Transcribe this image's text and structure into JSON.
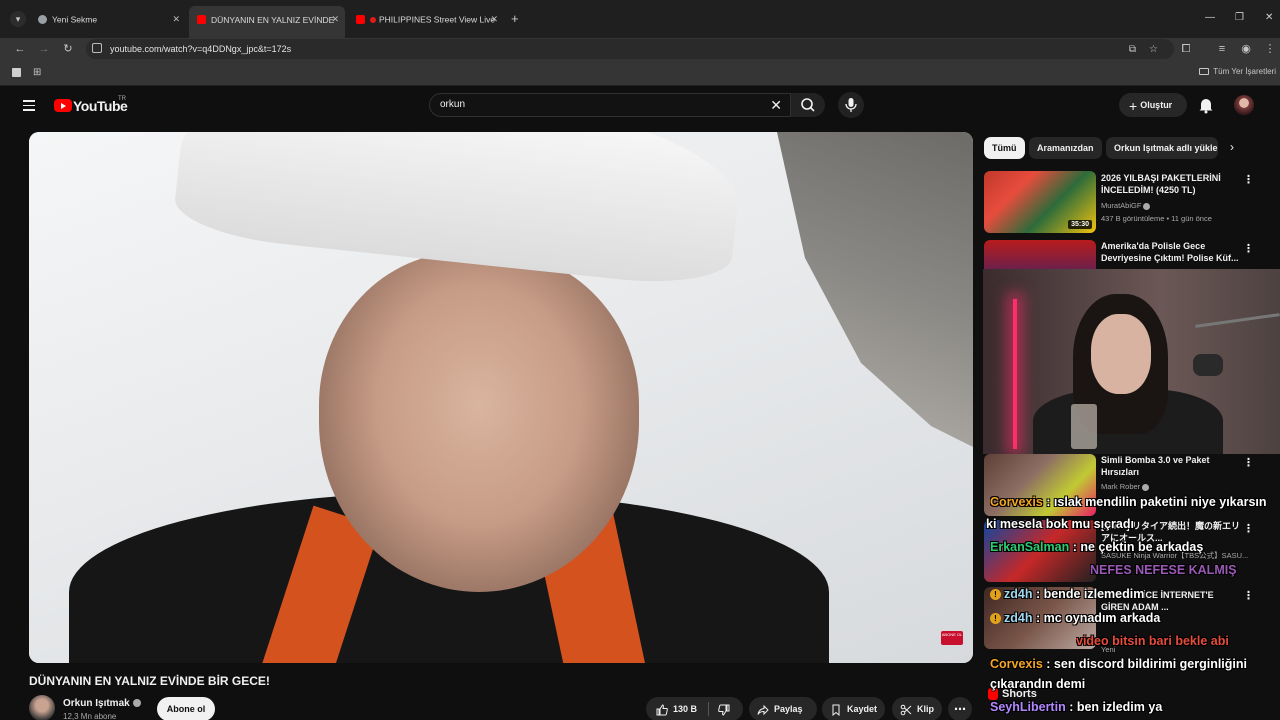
{
  "browser": {
    "tabs": [
      {
        "title": "Yeni Sekme",
        "active": false
      },
      {
        "title": "DÜNYANIN EN YALNIZ EVİNDE",
        "active": true
      },
      {
        "title": "PHILIPPINES Street View Live",
        "active": false
      }
    ],
    "url": "youtube.com/watch?v=q4DDNgx_jpc&t=172s",
    "bookmarks_all": "Tüm Yer İşaretleri"
  },
  "youtube": {
    "logo_text": "YouTube",
    "country_code": "TR",
    "search_value": "orkun",
    "create_label": "Oluştur"
  },
  "video": {
    "title": "DÜNYANIN EN YALNIZ EVİNDE BİR GECE!",
    "watermark": "ABONE OL",
    "channel": "Orkun Işıtmak",
    "subscribers": "12,3 Mn abone",
    "subscribe_label": "Abone ol",
    "likes": "130 B",
    "share_label": "Paylaş",
    "save_label": "Kaydet",
    "clip_label": "Klip",
    "more_label": "⋯"
  },
  "chips": [
    "Tümü",
    "Aramanızdan",
    "Orkun Işıtmak adlı yükle"
  ],
  "recommendations": [
    {
      "title": "2026 YILBAŞI PAKETLERİNİ İNCELEDİM! (4250 TL)",
      "channel": "MuratAbiGF",
      "meta": "437 B görüntüleme • 11 gün önce",
      "duration": "35:30"
    },
    {
      "title": "Amerika'da Polisle Gece Devriyesine Çıktım! Polise Küf...",
      "channel": "",
      "meta": "",
      "duration": ""
    },
    {
      "title": "Simli Bomba 3.0 ve Paket Hırsızları",
      "channel": "Mark Rober",
      "meta": "",
      "duration": ""
    },
    {
      "title": "[26/39] リタイア続出！魔の新エリアにオールス...",
      "channel": "SASUKE Ninja Warrior【TBS公式】SASU...",
      "meta": "",
      "duration": ""
    },
    {
      "title": "KEN GİZLİCE İNTERNET'E GİREN ADAM ...",
      "channel": "",
      "meta": "Yeni",
      "duration": ""
    }
  ],
  "shorts_label": "Shorts",
  "chat": [
    {
      "user": "Corvexis",
      "message": "ıslak mendilin paketini niye yıkarsın",
      "color": "#f5a623"
    },
    {
      "user": "",
      "message": "ki mesela bok mu sıçradı",
      "color": "#ffffff"
    },
    {
      "user": "ErkanSalman",
      "message": "ne çektin be arkadaş",
      "color": "#2ecc71"
    },
    {
      "user": "",
      "message": "NEFES NEFESE KALMIŞ",
      "color": "#9b59b6"
    },
    {
      "user": "zd4h",
      "message": "bende izlemedim",
      "color": "#a0d8ef"
    },
    {
      "user": "zd4h",
      "message": "mc oynadım arkada",
      "color": "#a0d8ef"
    },
    {
      "user": "",
      "message": "video bitsin bari bekle abi",
      "color": "#e74c3c"
    },
    {
      "user": "Corvexis",
      "message": "sen discord bildirimi gerginliğini",
      "color": "#f5a623"
    },
    {
      "user": "",
      "message": "çıkarandın demi",
      "color": "#ffffff"
    },
    {
      "user": "SeyhLibertin",
      "message": "ben izledim ya",
      "color": "#b388ff"
    }
  ]
}
